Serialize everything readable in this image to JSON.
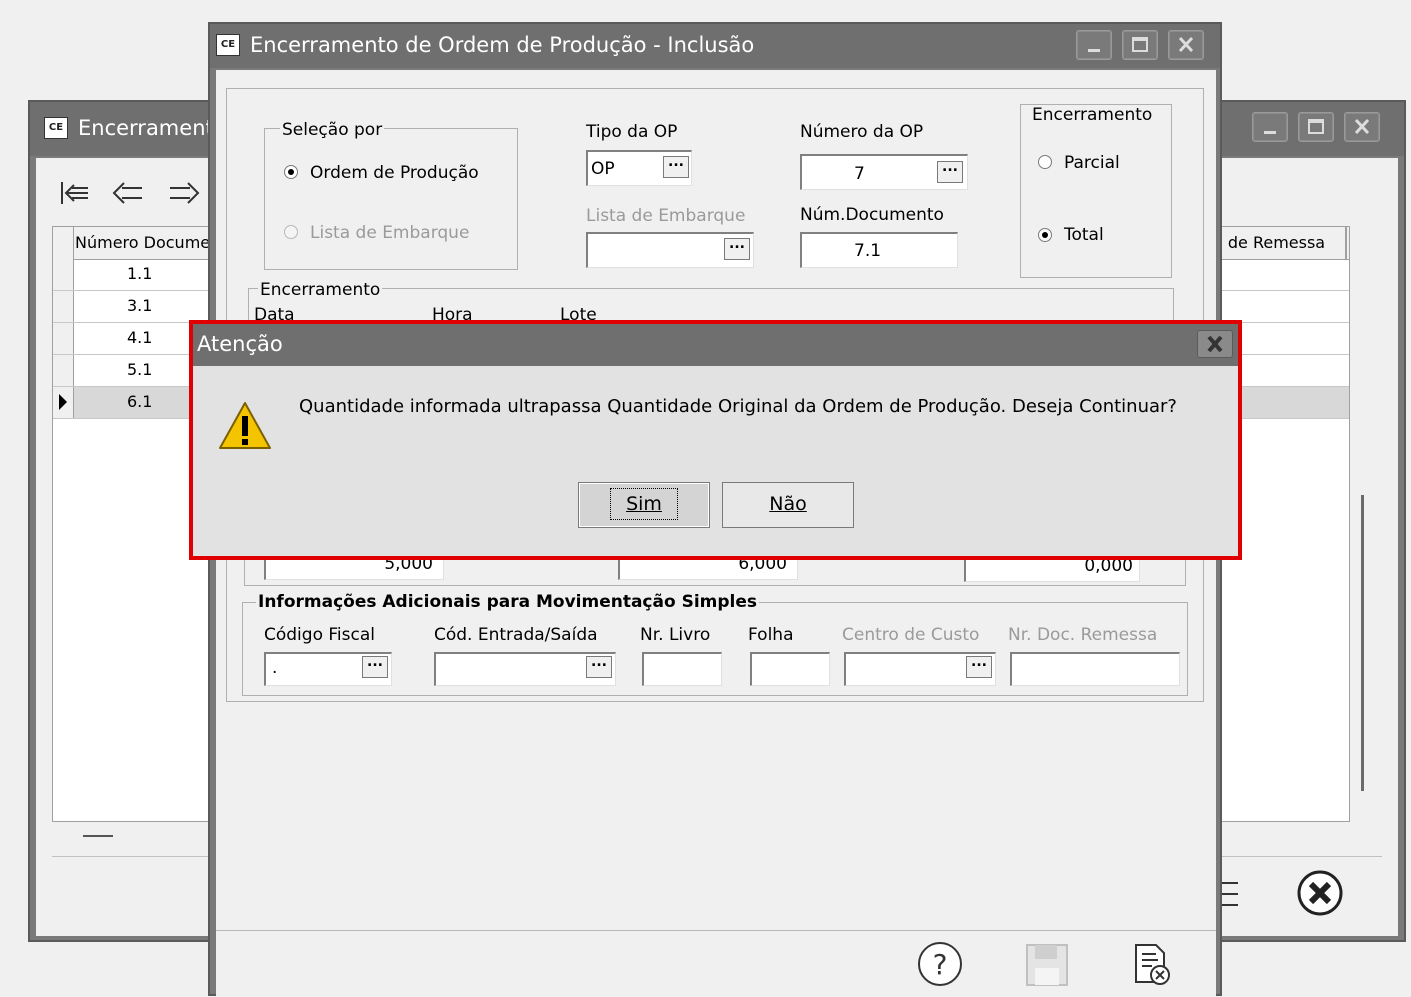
{
  "back_window": {
    "title": "Encerrament",
    "nav_icons": [
      "first-record-icon",
      "previous-record-icon",
      "next-record-icon"
    ],
    "grid": {
      "col1_header": "Número Docume",
      "col2_header": "o de Remessa",
      "rows": [
        "1.1",
        "3.1",
        "4.1",
        "5.1",
        "6.1"
      ],
      "selected_row": "6.1"
    },
    "buttons": [
      "cancel-icon"
    ]
  },
  "main_window": {
    "title": "Encerramento de Ordem de Produção - Inclusão",
    "selecao": {
      "legend": "Seleção por",
      "opt1": "Ordem de Produção",
      "opt2": "Lista de Embarque",
      "selected": "Ordem de Produção"
    },
    "tipo_op": {
      "label": "Tipo da OP",
      "value": "OP"
    },
    "numero_op": {
      "label": "Número da OP",
      "value": "7"
    },
    "lista_embarque": {
      "label": "Lista de Embarque",
      "value": ""
    },
    "num_documento": {
      "label": "Núm.Documento",
      "value": "7.1"
    },
    "encerramento_tipo": {
      "legend": "Encerramento",
      "opt1": "Parcial",
      "opt2": "Total",
      "selected": "Total"
    },
    "encerramento_group": {
      "legend": "Encerramento",
      "data_label": "Data",
      "hora_label": "Hora",
      "lote_label": "Lote"
    },
    "quantities": [
      "5,000",
      "6,000",
      "0,000"
    ],
    "info_adicionais": {
      "legend": "Informações Adicionais para Movimentação Simples",
      "codigo_fiscal": {
        "label": "Código Fiscal",
        "value": "."
      },
      "cod_entrada_saida": {
        "label": "Cód. Entrada/Saída",
        "value": ""
      },
      "nr_livro": {
        "label": "Nr. Livro",
        "value": ""
      },
      "folha": {
        "label": "Folha",
        "value": ""
      },
      "centro_custo": {
        "label": "Centro de Custo",
        "value": ""
      },
      "nr_doc_remessa": {
        "label": "Nr. Doc. Remessa",
        "value": ""
      }
    },
    "footer_icons": [
      "help-icon",
      "save-icon",
      "cancel-document-icon"
    ]
  },
  "dialog": {
    "title": "Atenção",
    "message": "Quantidade informada ultrapassa Quantidade Original da Ordem de Produção. Deseja Continuar?",
    "yes_label": "Sim",
    "no_label": "Não",
    "highlight_color": "#e00000"
  }
}
